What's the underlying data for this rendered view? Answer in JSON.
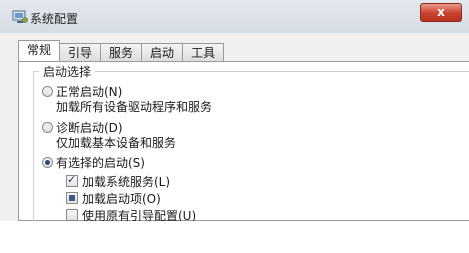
{
  "window": {
    "title": "系统配置",
    "close_label": "x"
  },
  "tabs": [
    "常规",
    "引导",
    "服务",
    "启动",
    "工具"
  ],
  "startup": {
    "group_label": "启动选择",
    "options": [
      {
        "label": "正常启动(N)",
        "desc": "加载所有设备驱动程序和服务",
        "selected": false
      },
      {
        "label": "诊断启动(D)",
        "desc": "仅加载基本设备和服务",
        "selected": false
      },
      {
        "label": "有选择的启动(S)",
        "selected": true
      }
    ],
    "checks": [
      {
        "label": "加载系统服务(L)",
        "state": "checked"
      },
      {
        "label": "加载启动项(O)",
        "state": "partial"
      },
      {
        "label": "使用原有引导配置(U)",
        "state": "unchecked"
      }
    ]
  }
}
